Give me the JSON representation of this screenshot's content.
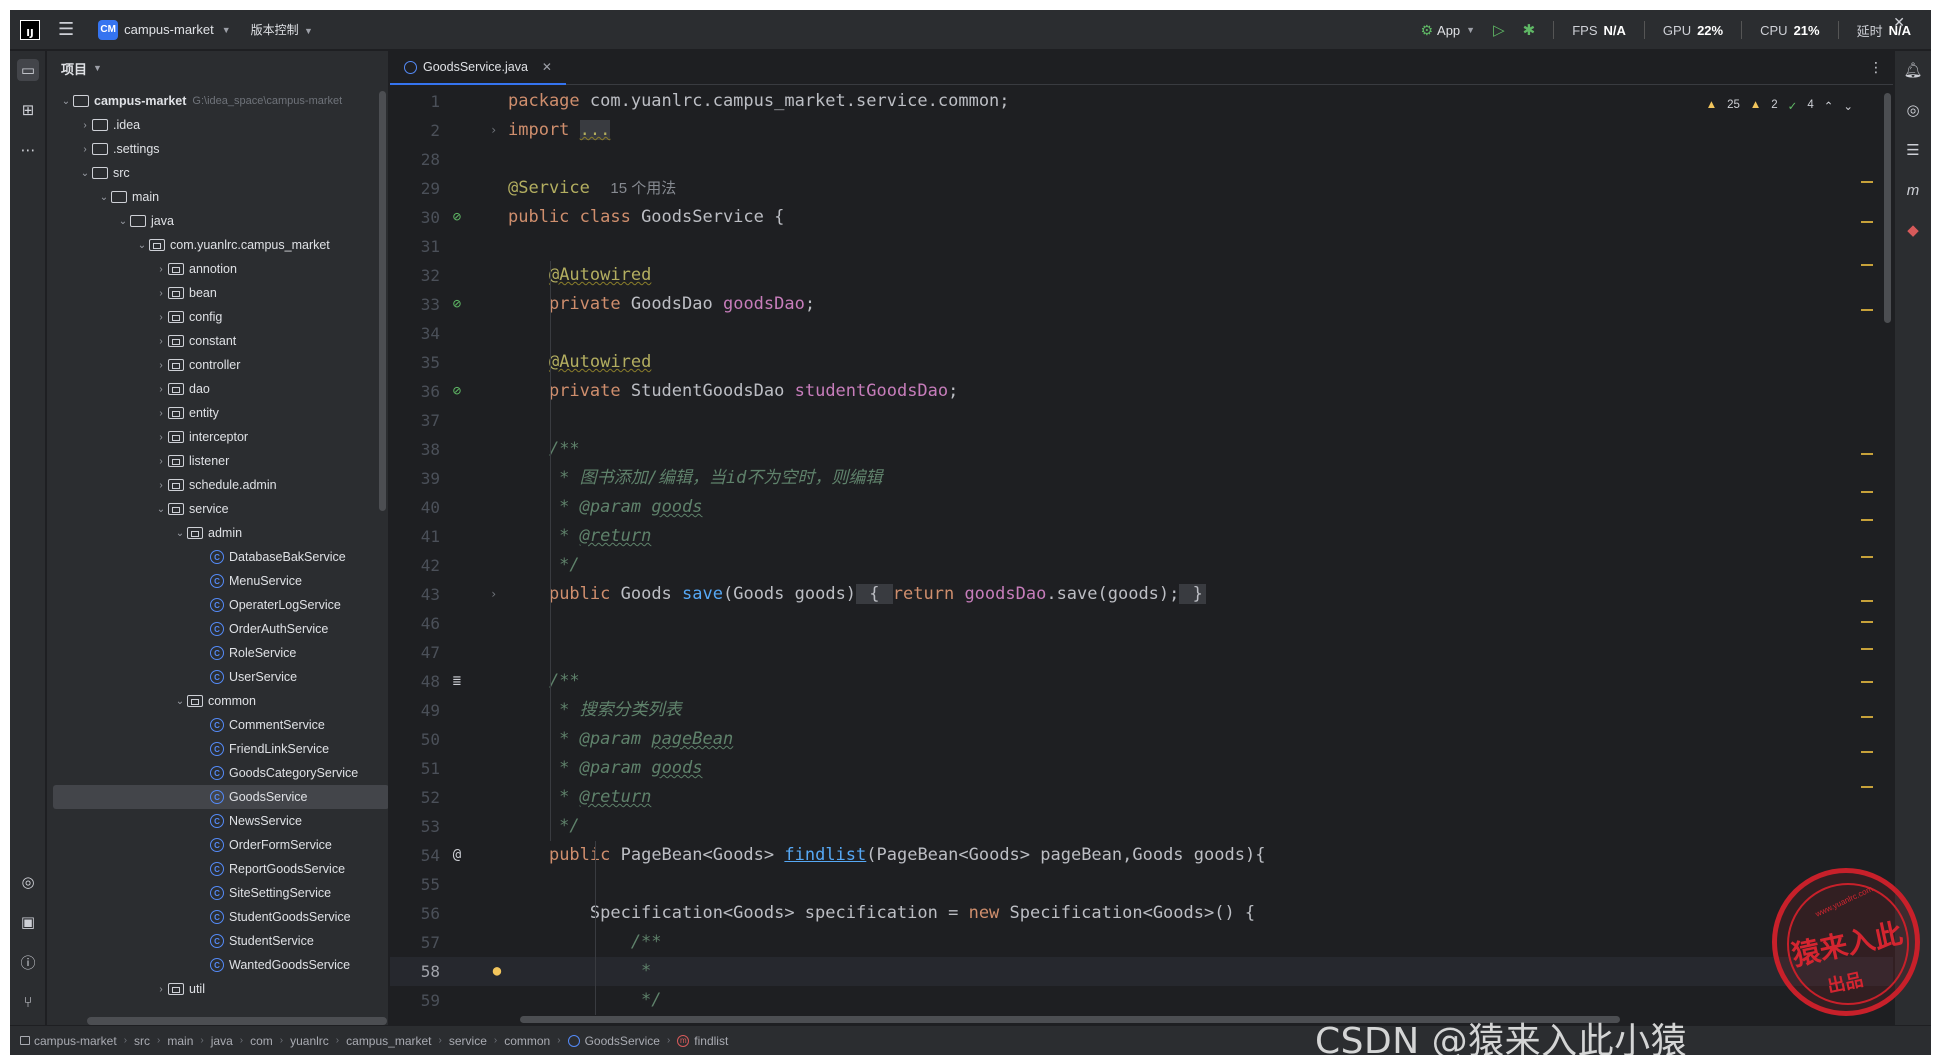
{
  "titlebar": {
    "logo": "IJ",
    "project_badge": "CM",
    "project_name": "campus-market",
    "vcs_label": "版本控制",
    "run_config": "App",
    "metrics": [
      {
        "label": "FPS",
        "value": "N/A"
      },
      {
        "label": "GPU",
        "value": "22%"
      },
      {
        "label": "CPU",
        "value": "21%"
      },
      {
        "label": "延时",
        "value": "N/A"
      }
    ]
  },
  "project_panel": {
    "title": "项目",
    "tree": [
      {
        "label": "campus-market",
        "hint": "G:\\idea_space\\campus-market",
        "type": "module",
        "depth": 0,
        "expanded": true
      },
      {
        "label": ".idea",
        "type": "folder",
        "depth": 1,
        "expanded": false
      },
      {
        "label": ".settings",
        "type": "folder",
        "depth": 1,
        "expanded": false
      },
      {
        "label": "src",
        "type": "folder",
        "depth": 1,
        "expanded": true
      },
      {
        "label": "main",
        "type": "folder",
        "depth": 2,
        "expanded": true
      },
      {
        "label": "java",
        "type": "folder",
        "depth": 3,
        "expanded": true
      },
      {
        "label": "com.yuanlrc.campus_market",
        "type": "package",
        "depth": 4,
        "expanded": true
      },
      {
        "label": "annotion",
        "type": "package",
        "depth": 5,
        "expanded": false
      },
      {
        "label": "bean",
        "type": "package",
        "depth": 5,
        "expanded": false
      },
      {
        "label": "config",
        "type": "package",
        "depth": 5,
        "expanded": false
      },
      {
        "label": "constant",
        "type": "package",
        "depth": 5,
        "expanded": false
      },
      {
        "label": "controller",
        "type": "package",
        "depth": 5,
        "expanded": false
      },
      {
        "label": "dao",
        "type": "package",
        "depth": 5,
        "expanded": false
      },
      {
        "label": "entity",
        "type": "package",
        "depth": 5,
        "expanded": false
      },
      {
        "label": "interceptor",
        "type": "package",
        "depth": 5,
        "expanded": false
      },
      {
        "label": "listener",
        "type": "package",
        "depth": 5,
        "expanded": false
      },
      {
        "label": "schedule.admin",
        "type": "package",
        "depth": 5,
        "expanded": false
      },
      {
        "label": "service",
        "type": "package",
        "depth": 5,
        "expanded": true
      },
      {
        "label": "admin",
        "type": "package",
        "depth": 6,
        "expanded": true
      },
      {
        "label": "DatabaseBakService",
        "type": "class",
        "depth": 7
      },
      {
        "label": "MenuService",
        "type": "class",
        "depth": 7
      },
      {
        "label": "OperaterLogService",
        "type": "class",
        "depth": 7
      },
      {
        "label": "OrderAuthService",
        "type": "class",
        "depth": 7
      },
      {
        "label": "RoleService",
        "type": "class",
        "depth": 7
      },
      {
        "label": "UserService",
        "type": "class",
        "depth": 7
      },
      {
        "label": "common",
        "type": "package",
        "depth": 6,
        "expanded": true
      },
      {
        "label": "CommentService",
        "type": "class",
        "depth": 7
      },
      {
        "label": "FriendLinkService",
        "type": "class",
        "depth": 7
      },
      {
        "label": "GoodsCategoryService",
        "type": "class",
        "depth": 7
      },
      {
        "label": "GoodsService",
        "type": "class",
        "depth": 7,
        "selected": true
      },
      {
        "label": "NewsService",
        "type": "class",
        "depth": 7
      },
      {
        "label": "OrderFormService",
        "type": "class",
        "depth": 7
      },
      {
        "label": "ReportGoodsService",
        "type": "class",
        "depth": 7
      },
      {
        "label": "SiteSettingService",
        "type": "class",
        "depth": 7
      },
      {
        "label": "StudentGoodsService",
        "type": "class",
        "depth": 7
      },
      {
        "label": "StudentService",
        "type": "class",
        "depth": 7
      },
      {
        "label": "WantedGoodsService",
        "type": "class",
        "depth": 7
      },
      {
        "label": "util",
        "type": "package",
        "depth": 5,
        "expanded": false
      }
    ]
  },
  "editor": {
    "tab_label": "GoodsService.java",
    "inspections": {
      "warnings": "25",
      "weak_warnings": "2",
      "ok": "4"
    },
    "lines": [
      {
        "n": "1",
        "html": "<span class=\"kw\">package</span> com.yuanlrc.campus_market.service.common;"
      },
      {
        "n": "2",
        "html": "<span class=\"kw\">import</span> <span class=\"fold-dots\">...</span>",
        "fold": "›"
      },
      {
        "n": "28",
        "html": ""
      },
      {
        "n": "29",
        "html": "<span style=\"color:#b3ae60\">@Service</span>  <span class=\"hint2\">15 个用法</span>"
      },
      {
        "n": "30",
        "html": "<span class=\"kw\">public class</span> GoodsService {",
        "gutter": "leaf"
      },
      {
        "n": "31",
        "html": ""
      },
      {
        "n": "32",
        "html": "    <span class=\"ann\">@Autowired</span>"
      },
      {
        "n": "33",
        "html": "    <span class=\"kw\">private</span> GoodsDao <span class=\"fld\">goodsDao</span>;",
        "gutter": "leaf"
      },
      {
        "n": "34",
        "html": ""
      },
      {
        "n": "35",
        "html": "    <span class=\"ann\">@Autowired</span>"
      },
      {
        "n": "36",
        "html": "    <span class=\"kw\">private</span> StudentGoodsDao <span class=\"fld\">studentGoodsDao</span>;",
        "gutter": "leaf"
      },
      {
        "n": "37",
        "html": ""
      },
      {
        "n": "38",
        "html": "    <span class=\"cmt\">/**</span>"
      },
      {
        "n": "39",
        "html": "<span class=\"cmt\">     * 图书添加/编辑，当id不为空时，则编辑</span>"
      },
      {
        "n": "40",
        "html": "<span class=\"cmt\">     * </span><span class=\"cmt\">@param</span> <span class=\"tag\">goods</span>"
      },
      {
        "n": "41",
        "html": "<span class=\"cmt\">     * </span><span class=\"tag\">@return</span>"
      },
      {
        "n": "42",
        "html": "<span class=\"cmt\">     */</span>"
      },
      {
        "n": "43",
        "html": "    <span class=\"kw\">public</span> Goods <span class=\"mth\">save</span>(Goods goods)<span class=\"fold-box\"> { </span><span class=\"kw\">return</span> <span class=\"fld\">goodsDao</span>.save(goods);<span class=\"fold-box\"> }</span>",
        "fold": "›"
      },
      {
        "n": "46",
        "html": ""
      },
      {
        "n": "47",
        "html": ""
      },
      {
        "n": "48",
        "html": "    <span class=\"cmt\">/**</span>",
        "gutter": "doc"
      },
      {
        "n": "49",
        "html": "<span class=\"cmt\">     * 搜索分类列表</span>"
      },
      {
        "n": "50",
        "html": "<span class=\"cmt\">     * </span><span class=\"cmt\">@param</span> <span class=\"tag\">pageBean</span>"
      },
      {
        "n": "51",
        "html": "<span class=\"cmt\">     * </span><span class=\"cmt\">@param</span> <span class=\"tag\">goods</span>"
      },
      {
        "n": "52",
        "html": "<span class=\"cmt\">     * </span><span class=\"tag\">@return</span>"
      },
      {
        "n": "53",
        "html": "<span class=\"cmt\">     */</span>"
      },
      {
        "n": "54",
        "html": "    <span class=\"kw\">public</span> PageBean&lt;Goods&gt; <span class=\"mthu\">findlist</span>(PageBean&lt;Goods&gt; pageBean,Goods goods){",
        "gutter": "at"
      },
      {
        "n": "55",
        "html": ""
      },
      {
        "n": "56",
        "html": "        Specification&lt;Goods&gt; specification = <span class=\"kw\">new</span> Specification&lt;Goods&gt;() {"
      },
      {
        "n": "57",
        "html": "<span class=\"cmt\">            /**</span>"
      },
      {
        "n": "58",
        "html": "<span class=\"cmt\">             *</span>",
        "current": true,
        "bulb": true
      },
      {
        "n": "59",
        "html": "<span class=\"cmt\">             */</span>"
      }
    ]
  },
  "statusbar": {
    "breadcrumb": [
      "campus-market",
      "src",
      "main",
      "java",
      "com",
      "yuanlrc",
      "campus_market",
      "service",
      "common",
      "GoodsService",
      "findlist"
    ]
  },
  "watermark": {
    "text": "CSDN @猿来入此小猿",
    "seal_text": "猿来入此",
    "seal_sub": "出品",
    "seal_url": "www.yuanlrc.com"
  },
  "icons": {
    "leaf": "spring-bean-icon",
    "doc": "render-doc-icon",
    "at": "implemented-at-icon",
    "bulb": "intention-bulb-icon"
  },
  "colors": {
    "keyword": "#cf8e6d",
    "annotation": "#b3ae60",
    "field": "#c77dbb",
    "method": "#56a8f5",
    "comment": "#5f826b",
    "accent": "#3574f0"
  }
}
